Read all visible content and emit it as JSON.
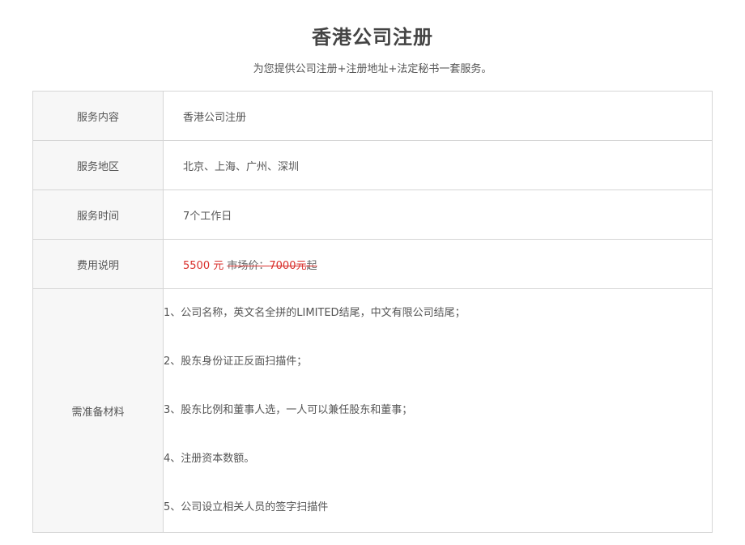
{
  "header": {
    "title": "香港公司注册",
    "subtitle": "为您提供公司注册+注册地址+法定秘书一套服务。"
  },
  "table": {
    "rows": [
      {
        "label": "服务内容",
        "value": "香港公司注册"
      },
      {
        "label": "服务地区",
        "value": "北京、上海、广州、深圳"
      },
      {
        "label": "服务时间",
        "value": "7个工作日"
      }
    ],
    "fee": {
      "label": "费用说明",
      "price": "5500 元",
      "market_label": "市场价：",
      "market_price": "7000元",
      "suffix": "起"
    },
    "materials": {
      "label": "需准备材料",
      "items": [
        "1、公司名称，英文名全拼的LIMITED结尾，中文有限公司结尾；",
        "2、股东身份证正反面扫描件；",
        "3、股东比例和董事人选，一人可以兼任股东和董事；",
        "4、注册资本数额。",
        "5、公司设立相关人员的签字扫描件"
      ]
    }
  },
  "colors": {
    "price": "#d9302c",
    "label_bg": "#f7f7f7",
    "border": "#d6d6d6",
    "text": "#555555"
  }
}
